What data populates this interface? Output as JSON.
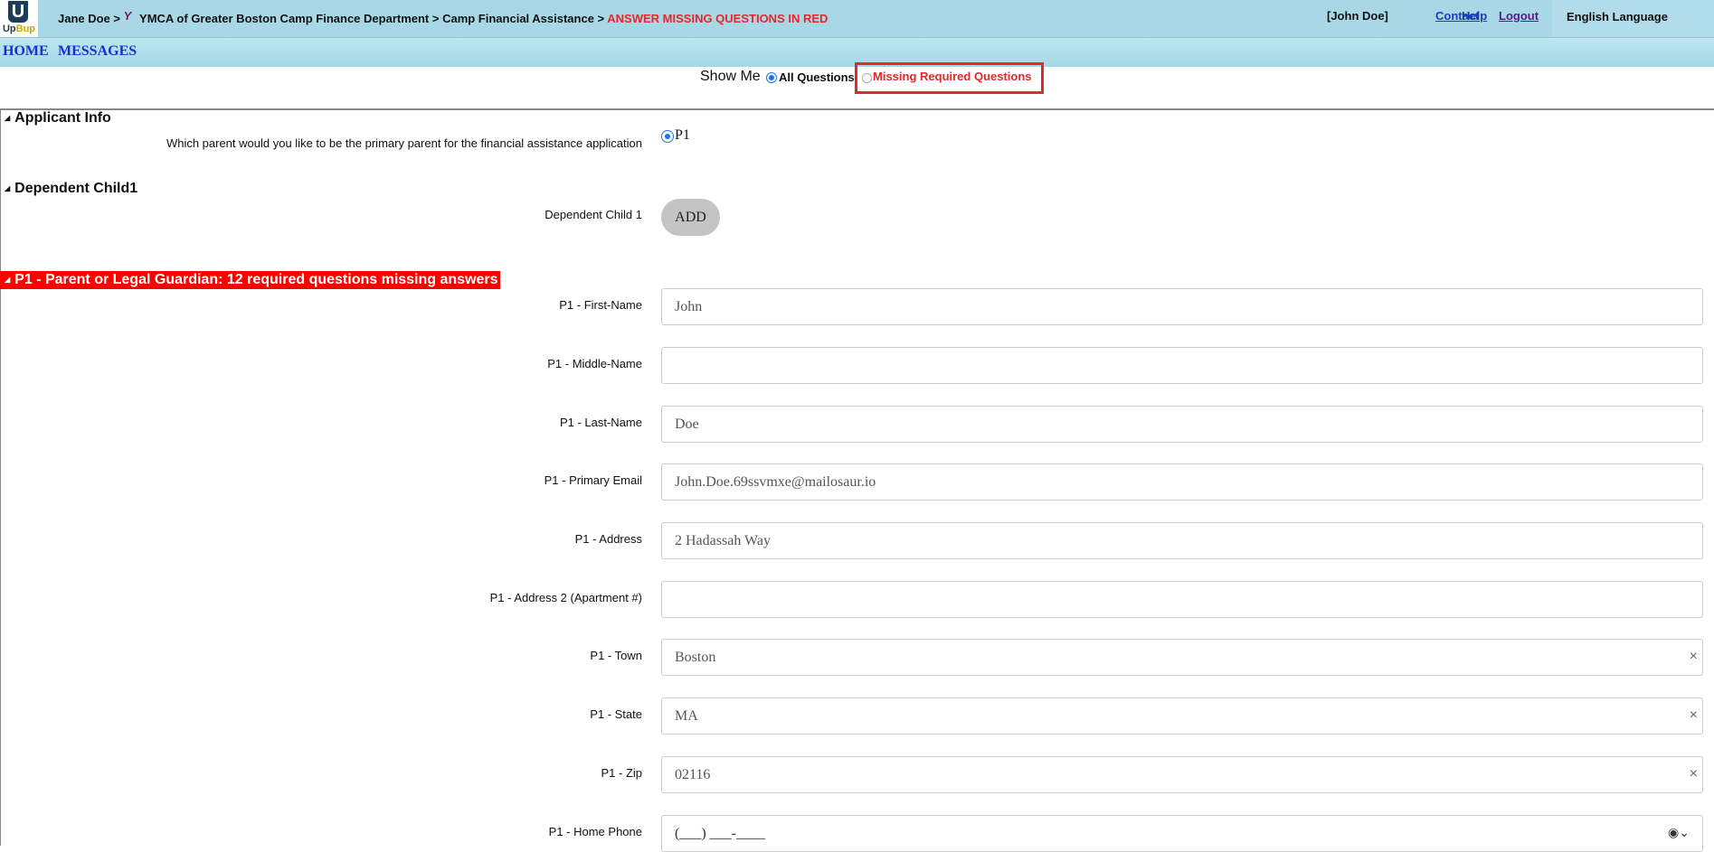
{
  "header": {
    "logo_mark": "U",
    "logo_word_a": "Up",
    "logo_word_b": "Bup",
    "crumb_user": "Jane Doe >",
    "y_mark": "Y",
    "crumb_org": "YMCA of Greater Boston Camp Finance Department > Camp Financial Assistance >",
    "crumb_current": "ANSWER MISSING QUESTIONS IN RED",
    "user_name": "[John  Doe]",
    "contact": "Contact",
    "help": "Help",
    "logout": "Logout",
    "language": "English Language",
    "colors": {
      "bar": "#a8d8e6",
      "alert": "#e8262a",
      "link": "#1a3fb5"
    }
  },
  "nav": {
    "home": "HOME",
    "messages": "MESSAGES"
  },
  "filter": {
    "label": "Show Me",
    "all": "All Questions",
    "missing": "Missing Required Questions",
    "selected": "All Questions"
  },
  "applicant": {
    "title": "Applicant Info",
    "question": "Which parent would you like to be the primary parent for the financial assistance application",
    "option": "P1"
  },
  "dependent": {
    "title": "Dependent Child1",
    "label": "Dependent Child 1",
    "button": "ADD"
  },
  "guardian": {
    "title": "P1 - Parent or Legal Guardian: 12 required questions missing answers",
    "fields": [
      {
        "label": "P1 - First-Name",
        "value": "John"
      },
      {
        "label": "P1 - Middle-Name",
        "value": ""
      },
      {
        "label": "P1 - Last-Name",
        "value": "Doe"
      },
      {
        "label": "P1 - Primary Email",
        "value": "John.Doe.69ssvmxe@mailosaur.io"
      },
      {
        "label": "P1 - Address",
        "value": "2 Hadassah Way"
      },
      {
        "label": "P1 - Address 2 (Apartment #)",
        "value": ""
      },
      {
        "label": "P1 - Town",
        "value": "Boston"
      },
      {
        "label": "P1 - State",
        "value": "MA"
      },
      {
        "label": "P1 - Zip",
        "value": "02116"
      },
      {
        "label": "P1 - Home Phone",
        "value": "(___) ___-____"
      }
    ]
  },
  "icons": {
    "clear": "×",
    "phone_picker": "◉⌄",
    "collapse": "◢"
  }
}
